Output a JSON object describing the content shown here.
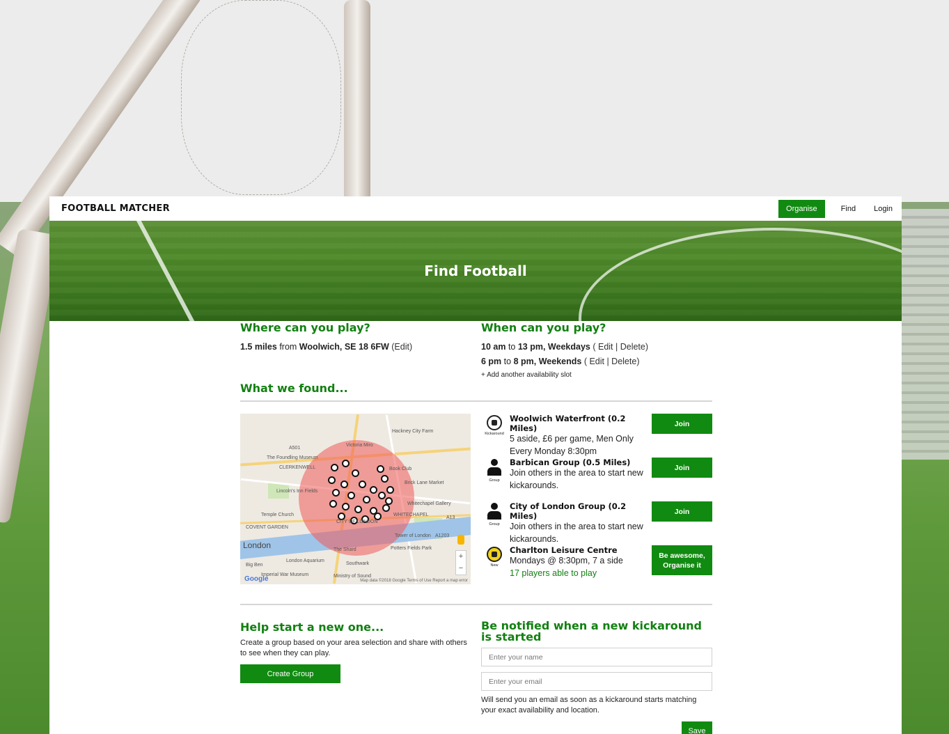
{
  "brand": "FOOTBALL MATCHER",
  "nav": {
    "organise": "Organise",
    "find": "Find",
    "login": "Login"
  },
  "hero_title": "Find Football",
  "where": {
    "heading": "Where can you play?",
    "distance": "1.5 miles",
    "from_text": "from",
    "location": "Woolwich, SE 18 6FW",
    "edit": "(Edit)"
  },
  "when": {
    "heading": "When can you play?",
    "slots": [
      {
        "start": "10 am",
        "to": "to",
        "end": "13 pm, Weekdays",
        "actions": "( Edit | Delete)"
      },
      {
        "start": "6 pm",
        "to": "to",
        "end": "8 pm, Weekends",
        "actions": "( Edit | Delete)"
      }
    ],
    "add_slot": "+ Add another availability slot"
  },
  "found_heading": "What we found...",
  "map": {
    "labels": [
      "Hackney City Farm",
      "Victoria Miro",
      "The Foundling Museum",
      "CLERKENWELL",
      "Book Club",
      "Brick Lane Market",
      "Lincoln's Inn Fields",
      "Temple Church",
      "Whitechapel Gallery",
      "WHITECHAPEL",
      "COVENT GARDEN",
      "Tower of London",
      "The Shard",
      "Potters Fields Park",
      "London Aquarium",
      "Big Ben",
      "Imperial War Museum",
      "Ministry of Sound",
      "Southwark",
      "A501",
      "A13",
      "A1203",
      "CITY OF LONDON"
    ],
    "city": "London",
    "google": "Google",
    "footer": "Map data ©2018 Google   Terms of Use   Report a map error"
  },
  "results": [
    {
      "icon": "kickaround",
      "tag": "Kickaround",
      "title": "Woolwich Waterfront (0.2 Miles)",
      "line1": "5 aside, £6 per game, Men Only",
      "line2": "Every Monday 8:30pm",
      "button": "Join"
    },
    {
      "icon": "group",
      "tag": "Group",
      "title": "Barbican Group (0.5 Miles)",
      "line1": "Join others in the area to start new",
      "line2": "kickarounds.",
      "button": "Join"
    },
    {
      "icon": "group",
      "tag": "Group",
      "title": "City of London Group (0.2 Miles)",
      "line1": "Join others in the area to start new",
      "line2": "kickarounds.",
      "button": "Join"
    },
    {
      "icon": "new",
      "tag": "New",
      "title": "Charlton Leisure Centre",
      "line1": "Mondays @ 8:30pm, 7 a side",
      "line2": "17 players able to play",
      "button": "Be awesome, Organise it"
    }
  ],
  "help": {
    "heading": "Help start a new one...",
    "text": "Create a group based on your area selection and share with others to see when they can play.",
    "button": "Create Group"
  },
  "notify": {
    "heading": "Be notified when a new kickaround is started",
    "name_placeholder": "Enter your name",
    "email_placeholder": "Enter your email",
    "text": "Will send you an email as soon as a kickaround starts matching your exact availability and location.",
    "button": "Save"
  },
  "colors": {
    "accent": "#118a11",
    "heading": "#128012"
  }
}
